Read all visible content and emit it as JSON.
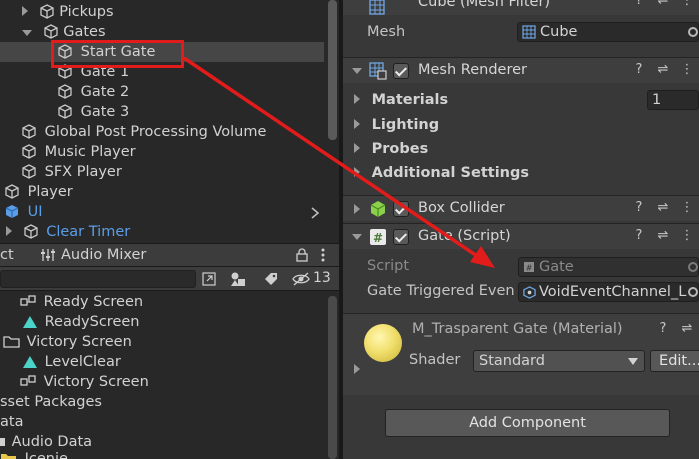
{
  "hierarchy": {
    "items": [
      {
        "label": "Pickups"
      },
      {
        "label": "Gates"
      },
      {
        "label": "Start Gate"
      },
      {
        "label": "Gate 1"
      },
      {
        "label": "Gate 2"
      },
      {
        "label": "Gate 3"
      },
      {
        "label": "Global Post Processing Volume"
      },
      {
        "label": "Music Player"
      },
      {
        "label": "SFX Player"
      },
      {
        "label": "Player"
      },
      {
        "label": "UI"
      },
      {
        "label": "Clear Timer"
      }
    ]
  },
  "project": {
    "tabs": [
      {
        "label": "ct"
      },
      {
        "label": "Audio Mixer"
      }
    ],
    "hidden_count": "13",
    "items": [
      {
        "label": "Ready Screen"
      },
      {
        "label": "ReadyScreen"
      },
      {
        "label": "Victory Screen"
      },
      {
        "label": "LevelClear"
      },
      {
        "label": "Victory Screen"
      },
      {
        "label": "sset Packages"
      },
      {
        "label": "ata"
      },
      {
        "label": "Audio Data"
      },
      {
        "label": "Icenie"
      }
    ]
  },
  "inspector": {
    "mesh_filter": {
      "title": "Cube (Mesh Filter)",
      "mesh_label": "Mesh",
      "mesh_value": "Cube"
    },
    "mesh_renderer": {
      "title": "Mesh Renderer",
      "sections": [
        "Materials",
        "Lighting",
        "Probes",
        "Additional Settings"
      ],
      "materials_count": "1"
    },
    "box_collider": {
      "title": "Box Collider"
    },
    "gate_script": {
      "title": "Gate (Script)",
      "script_label": "Script",
      "script_value": "Gate",
      "trigger_label": "Gate Triggered Even",
      "trigger_value": "VoidEventChannel_L"
    },
    "material": {
      "title": "M_Trasparent Gate (Material)",
      "shader_label": "Shader",
      "shader_value": "Standard",
      "edit_label": "Edit..."
    },
    "add_component_label": "Add Component"
  },
  "colors": {
    "annotation_red": "#e21b1b",
    "ui_blue": "#5a9ee8",
    "collider_green": "#8ad24a"
  }
}
